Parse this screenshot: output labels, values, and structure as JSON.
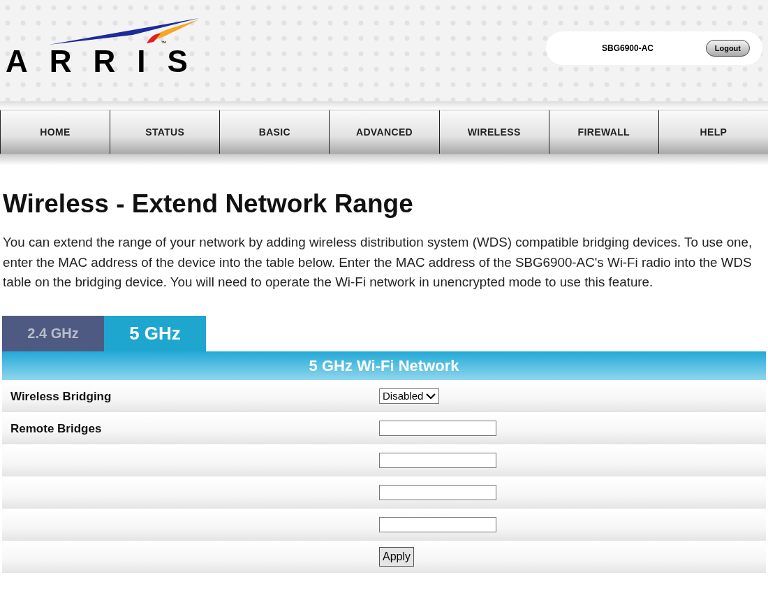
{
  "header": {
    "logo": {
      "wordmark": "ARRIS",
      "trademark": "™"
    },
    "model": "SBG6900-AC",
    "logout": "Logout"
  },
  "nav": [
    {
      "label": "HOME",
      "selected": false
    },
    {
      "label": "STATUS",
      "selected": false
    },
    {
      "label": "BASIC",
      "selected": false
    },
    {
      "label": "ADVANCED",
      "selected": false
    },
    {
      "label": "WIRELESS",
      "selected": false
    },
    {
      "label": "FIREWALL",
      "selected": false
    },
    {
      "label": "HELP",
      "selected": false
    }
  ],
  "page": {
    "title": "Wireless - Extend Network Range",
    "description": "You can extend the range of your network by adding wireless distribution system (WDS) compatible bridging devices. To use one, enter the MAC address of the device into the table below. Enter the MAC address of the SBG6900-AC's Wi-Fi radio into the WDS table on the bridging device. You will need to operate the Wi-Fi network in unencrypted mode to use this feature."
  },
  "tabs": [
    {
      "label": "2.4 GHz",
      "selected": false
    },
    {
      "label": "5 GHz",
      "selected": true
    }
  ],
  "table": {
    "title": "5 GHz Wi-Fi Network",
    "rows": [
      {
        "kind": "select",
        "label": "Wireless Bridging",
        "value": "Disabled"
      },
      {
        "kind": "input",
        "label": "Remote Bridges"
      },
      {
        "kind": "input"
      },
      {
        "kind": "input"
      },
      {
        "kind": "input"
      },
      {
        "kind": "button",
        "value": "Apply"
      }
    ]
  }
}
